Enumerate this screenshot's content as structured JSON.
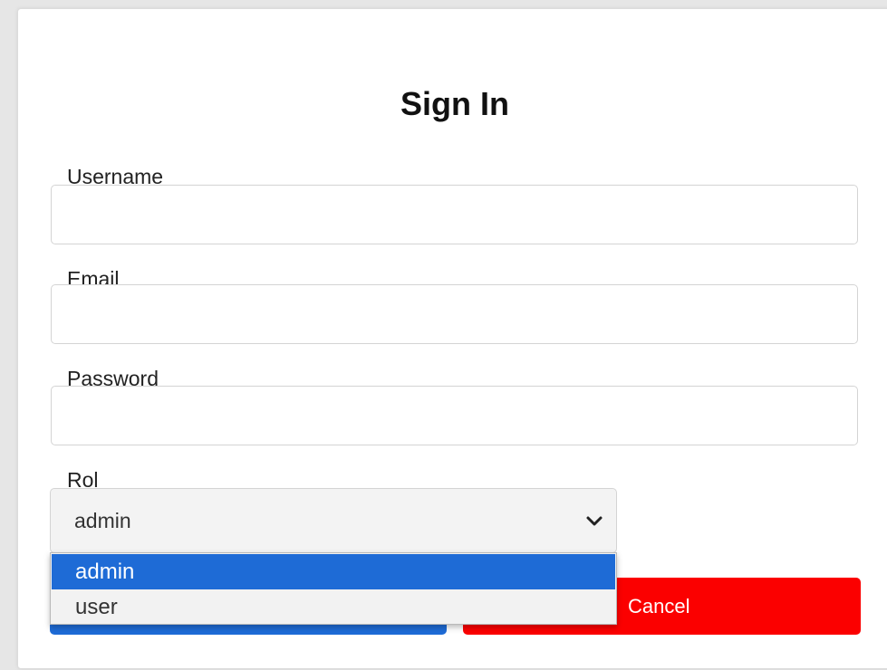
{
  "form": {
    "title": "Sign In",
    "username": {
      "label": "Username",
      "value": "",
      "placeholder": ""
    },
    "email": {
      "label": "Email",
      "value": "",
      "placeholder": ""
    },
    "password": {
      "label": "Password",
      "value": "",
      "placeholder": ""
    },
    "role": {
      "label": "Rol",
      "selected": "admin",
      "options": [
        {
          "label": "admin",
          "highlighted": true
        },
        {
          "label": "user",
          "highlighted": false
        }
      ]
    },
    "buttons": {
      "submit_label": "",
      "cancel_label": "Cancel"
    }
  },
  "colors": {
    "primary": "#1e6bd6",
    "cancel": "#fb0000",
    "highlight": "#1e6bd6"
  },
  "icons": {
    "select_chevron": "chevron-down-icon"
  }
}
